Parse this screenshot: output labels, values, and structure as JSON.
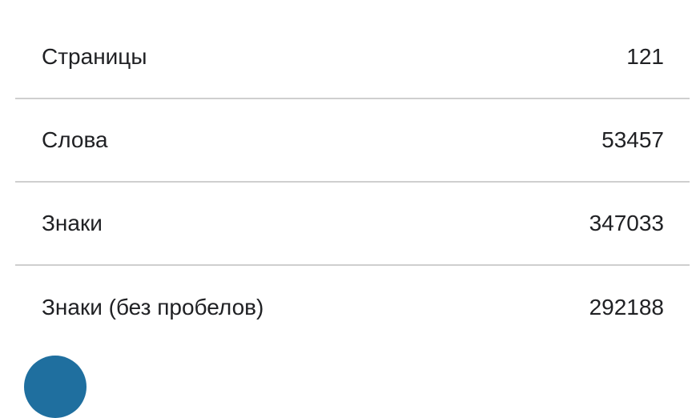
{
  "stats": {
    "rows": [
      {
        "label": "Страницы",
        "value": "121"
      },
      {
        "label": "Слова",
        "value": "53457"
      },
      {
        "label": "Знаки",
        "value": "347033"
      },
      {
        "label": "Знаки (без пробелов)",
        "value": "292188"
      }
    ]
  },
  "colors": {
    "divider": "#cfcfcf",
    "text": "#202124",
    "accent_circle": "#1f6f9f"
  }
}
